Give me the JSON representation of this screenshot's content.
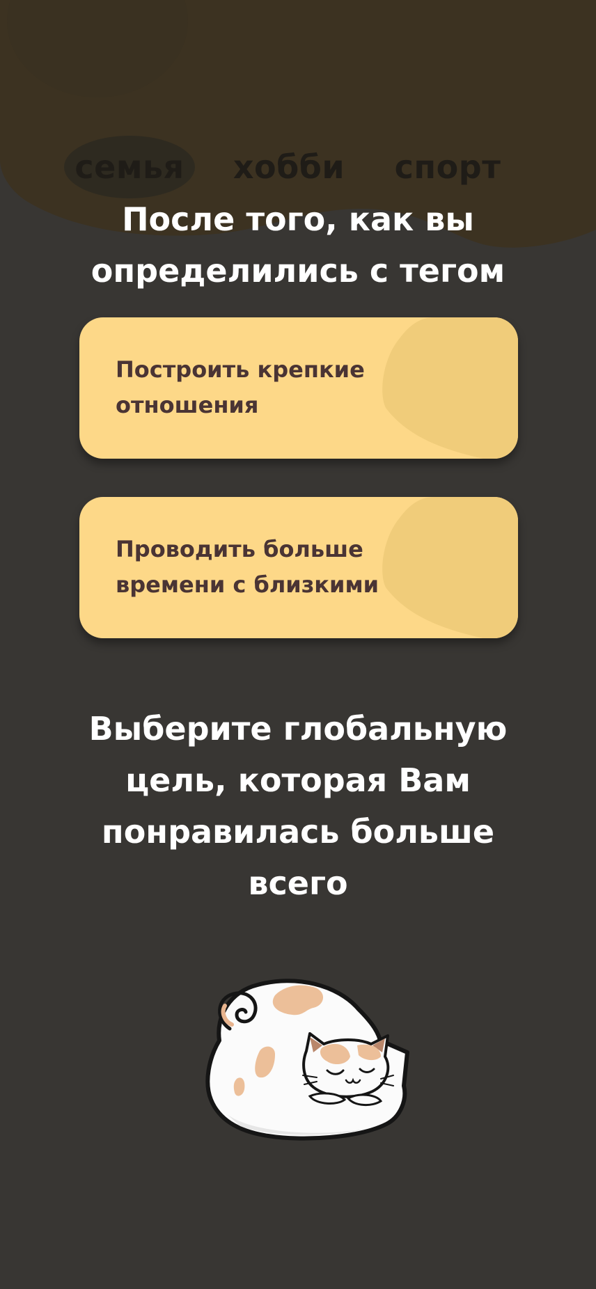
{
  "tags": [
    {
      "label": "семья",
      "active": true
    },
    {
      "label": "хобби",
      "active": false
    },
    {
      "label": "спорт",
      "active": false
    }
  ],
  "subtitle": {
    "line1": "После того, как вы",
    "line2": "определились с тегом"
  },
  "goals": [
    {
      "line1": "Построить крепкие",
      "line2": "отношения"
    },
    {
      "line1": "Проводить больше",
      "line2": "времени с близкими"
    }
  ],
  "question": {
    "line1": "Выберите глобальную",
    "line2": "цель, которая Вам",
    "line3": "понравилась больше",
    "line4": "всего"
  },
  "colors": {
    "background": "#383633",
    "top_blob": "#3c3221",
    "card": "#fdd888",
    "card_blob": "#f0cc7a",
    "card_text": "#4a3434"
  },
  "illustration": "sleeping-cat"
}
